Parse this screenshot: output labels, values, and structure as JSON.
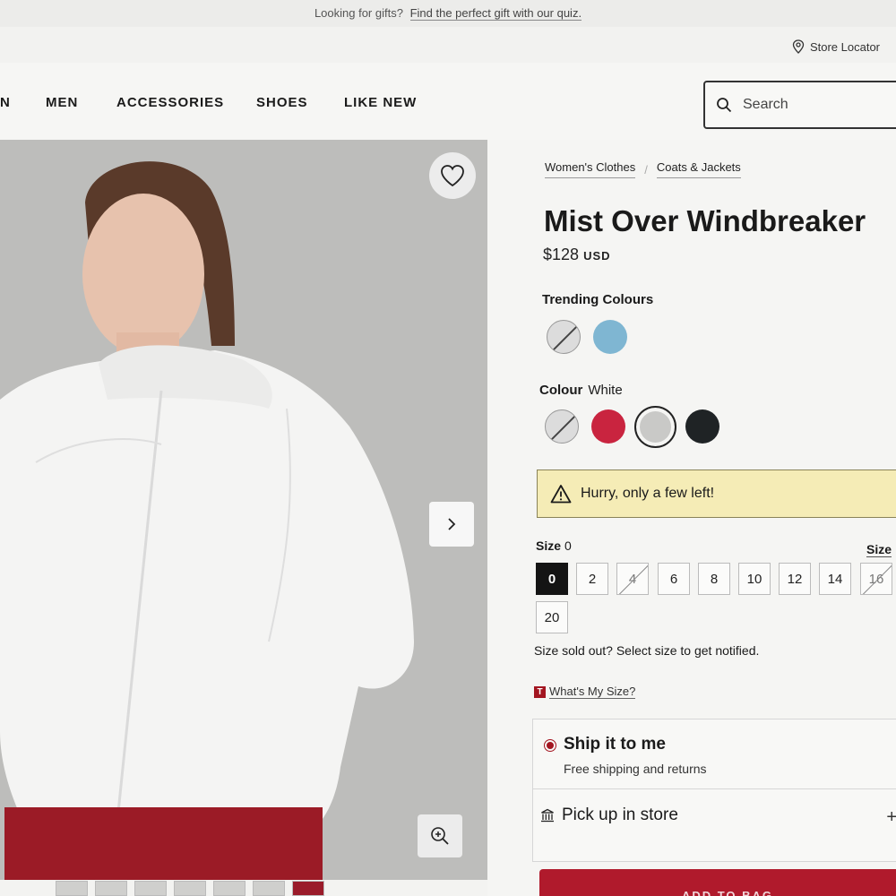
{
  "promo": {
    "text": "Looking for gifts?",
    "link": "Find the perfect gift with our quiz."
  },
  "utility": {
    "store_locator": "Store Locator"
  },
  "nav": {
    "items": [
      "N",
      "MEN",
      "ACCESSORIES",
      "SHOES",
      "LIKE NEW"
    ],
    "search_placeholder": "Search"
  },
  "breadcrumbs": [
    "Women's Clothes",
    "Coats & Jackets"
  ],
  "product": {
    "title": "Mist Over Windbreaker",
    "price": "$128",
    "currency": "USD"
  },
  "trending": {
    "label": "Trending Colours",
    "swatches": [
      {
        "name": "unavailable",
        "color": "#dcdcdc"
      },
      {
        "name": "blue",
        "color": "#7fb6d2"
      }
    ]
  },
  "colour": {
    "label": "Colour",
    "selected": "White",
    "swatches": [
      {
        "name": "unavailable",
        "color": "#dcdcdc"
      },
      {
        "name": "red",
        "color": "#c9243f"
      },
      {
        "name": "white",
        "color": "#c9c9c7"
      },
      {
        "name": "black",
        "color": "#1f2325"
      }
    ]
  },
  "alert": {
    "text": "Hurry, only a few left!"
  },
  "size": {
    "label": "Size",
    "selected": "0",
    "guide": "Size",
    "options": [
      {
        "label": "0",
        "state": "selected"
      },
      {
        "label": "2",
        "state": "available"
      },
      {
        "label": "4",
        "state": "sold-out"
      },
      {
        "label": "6",
        "state": "available"
      },
      {
        "label": "8",
        "state": "available"
      },
      {
        "label": "10",
        "state": "available"
      },
      {
        "label": "12",
        "state": "available"
      },
      {
        "label": "14",
        "state": "available"
      },
      {
        "label": "16",
        "state": "sold-out"
      },
      {
        "label": "20",
        "state": "available"
      }
    ],
    "soldout_text": "Size sold out? Select size to get notified.",
    "whats_my_size": "What's My Size?",
    "whats_badge": "T"
  },
  "shipping": {
    "ship_title": "Ship it to me",
    "ship_sub": "Free shipping and returns",
    "pickup": "Pick up in store",
    "pickup_expand": "+"
  },
  "cta": {
    "add_to_bag": "ADD TO BAG"
  },
  "colors": {
    "brand_red": "#b01a2c",
    "alert_bg": "#f5ecb6"
  }
}
